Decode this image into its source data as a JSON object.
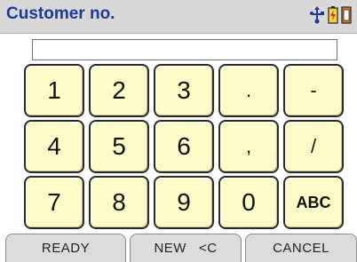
{
  "title": "Customer no.",
  "input": {
    "value": "",
    "placeholder": ""
  },
  "keys": [
    {
      "label": "1"
    },
    {
      "label": "2"
    },
    {
      "label": "3"
    },
    {
      "label": "."
    },
    {
      "label": "-"
    },
    {
      "label": "4"
    },
    {
      "label": "5"
    },
    {
      "label": "6"
    },
    {
      "label": ","
    },
    {
      "label": "/"
    },
    {
      "label": "7"
    },
    {
      "label": "8"
    },
    {
      "label": "9"
    },
    {
      "label": "0"
    },
    {
      "label": "ABC"
    }
  ],
  "softkeys": {
    "ready": "READY",
    "new": "NEW   <C",
    "cancel": "CANCEL"
  },
  "status_icons": [
    "usb-icon",
    "battery-charging-icon",
    "sd-card-icon"
  ],
  "colors": {
    "title": "#1a3a9c",
    "key_bg": "#fdfbc8",
    "bar_bg": "#d8d8d8"
  }
}
